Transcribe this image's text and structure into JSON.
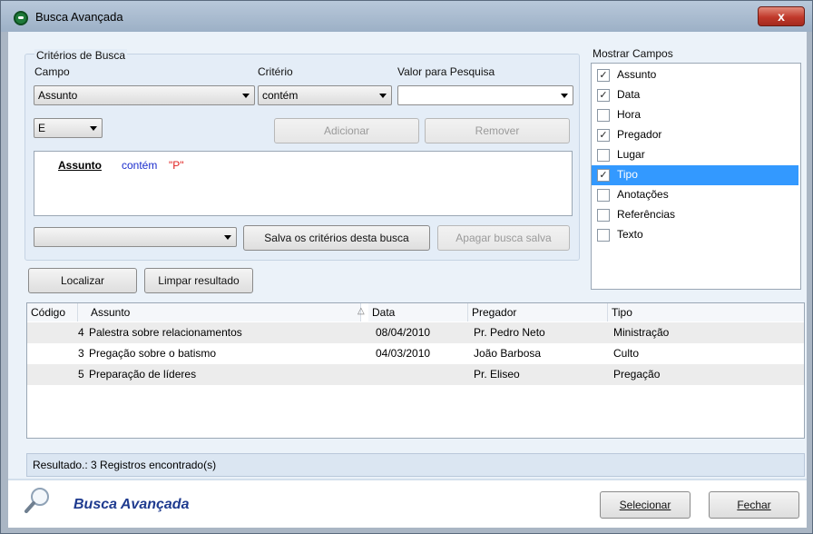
{
  "window": {
    "title": "Busca Avançada",
    "close": "x"
  },
  "criteria": {
    "group_title": "Critérios de Busca",
    "campo_label": "Campo",
    "criterio_label": "Critério",
    "valor_label": "Valor para Pesquisa",
    "campo_value": "Assunto",
    "criterio_value": "contém",
    "valor_value": "",
    "logic_value": "E",
    "add_button": "Adicionar",
    "remove_button": "Remover",
    "expr_field": "Assunto",
    "expr_op": "contém",
    "expr_value": "\"P\"",
    "saved_value": "",
    "save_button": "Salva os critérios desta busca",
    "delete_button": "Apagar busca salva"
  },
  "fields": {
    "title": "Mostrar Campos",
    "items": [
      {
        "label": "Assunto",
        "checked": true
      },
      {
        "label": "Data",
        "checked": true
      },
      {
        "label": "Hora",
        "checked": false
      },
      {
        "label": "Pregador",
        "checked": true
      },
      {
        "label": "Lugar",
        "checked": false
      },
      {
        "label": "Tipo",
        "checked": true,
        "selected": true
      },
      {
        "label": "Anotações",
        "checked": false
      },
      {
        "label": "Referências",
        "checked": false
      },
      {
        "label": "Texto",
        "checked": false
      }
    ]
  },
  "actions": {
    "find": "Localizar",
    "clear": "Limpar resultado"
  },
  "grid": {
    "headers": [
      "Código",
      "Assunto",
      "Data",
      "Pregador",
      "Tipo"
    ],
    "sort_indicator": "△",
    "rows": [
      {
        "codigo": "4",
        "assunto": "Palestra sobre relacionamentos",
        "data": "08/04/2010",
        "pregador": "Pr. Pedro Neto",
        "tipo": "Ministração"
      },
      {
        "codigo": "3",
        "assunto": "Pregação sobre o batismo",
        "data": "04/03/2010",
        "pregador": "João Barbosa",
        "tipo": "Culto"
      },
      {
        "codigo": "5",
        "assunto": "Preparação de líderes",
        "data": "",
        "pregador": "Pr. Eliseo",
        "tipo": "Pregação"
      }
    ]
  },
  "status": "Resultado.: 3 Registros encontrado(s)",
  "footer": {
    "title": "Busca Avançada",
    "select_button": "Selecionar",
    "close_button": "Fechar"
  }
}
